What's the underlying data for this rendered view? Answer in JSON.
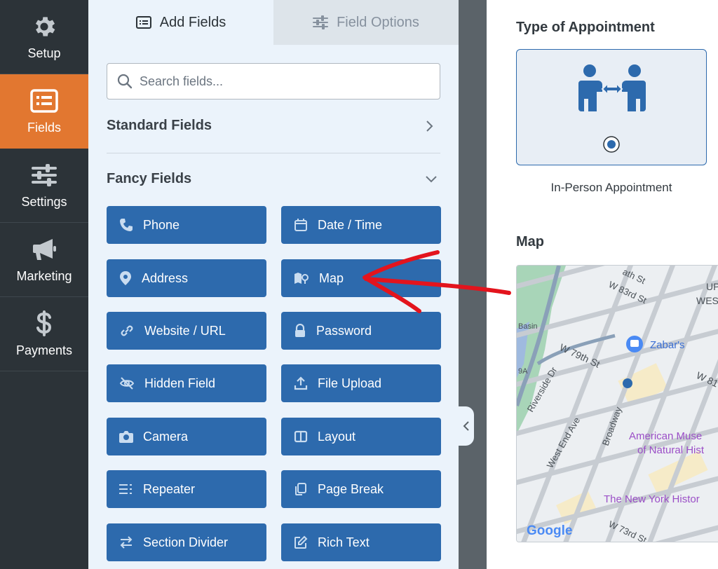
{
  "nav": {
    "items": [
      {
        "label": "Setup",
        "icon": "gear-icon"
      },
      {
        "label": "Fields",
        "icon": "list-icon",
        "active": true
      },
      {
        "label": "Settings",
        "icon": "sliders-icon"
      },
      {
        "label": "Marketing",
        "icon": "megaphone-icon"
      },
      {
        "label": "Payments",
        "icon": "dollar-icon"
      }
    ]
  },
  "panel": {
    "tabs": [
      {
        "label": "Add Fields",
        "icon": "list-box-icon",
        "active": true
      },
      {
        "label": "Field Options",
        "icon": "sliders-icon",
        "active": false
      }
    ],
    "search": {
      "placeholder": "Search fields..."
    },
    "standard_group": {
      "label": "Standard Fields"
    },
    "fancy_group": {
      "label": "Fancy Fields"
    },
    "fancy_fields": [
      {
        "label": "Phone",
        "icon": "phone-icon"
      },
      {
        "label": "Date / Time",
        "icon": "calendar-icon"
      },
      {
        "label": "Address",
        "icon": "map-pin-icon"
      },
      {
        "label": "Map",
        "icon": "map-icon"
      },
      {
        "label": "Website / URL",
        "icon": "link-icon"
      },
      {
        "label": "Password",
        "icon": "lock-icon"
      },
      {
        "label": "Hidden Field",
        "icon": "eye-slash-icon"
      },
      {
        "label": "File Upload",
        "icon": "upload-icon"
      },
      {
        "label": "Camera",
        "icon": "camera-icon"
      },
      {
        "label": "Layout",
        "icon": "columns-icon"
      },
      {
        "label": "Repeater",
        "icon": "repeater-icon"
      },
      {
        "label": "Page Break",
        "icon": "copy-icon"
      },
      {
        "label": "Section Divider",
        "icon": "arrows-icon"
      },
      {
        "label": "Rich Text",
        "icon": "edit-icon"
      }
    ]
  },
  "preview": {
    "appointment": {
      "title": "Type of Appointment",
      "option_label": "In-Person Appointment",
      "selected": true
    },
    "map": {
      "title": "Map",
      "labels": [
        "W 83rd St",
        "W 79th St",
        "Riverside Dr",
        "West End Ave",
        "Broadway",
        "Zabar's",
        "American Muse",
        "of Natural Hist",
        "The New York Histor",
        "W 73rd St",
        "UP",
        "WES",
        "W 81",
        "9A",
        "Basin",
        "ath St"
      ],
      "attribution": "Google"
    }
  },
  "colors": {
    "nav_bg": "#2c3338",
    "nav_active": "#e27730",
    "button_blue": "#2d6aad",
    "panel_bg": "#ebf3fb",
    "annotation_red": "#e3141d"
  }
}
